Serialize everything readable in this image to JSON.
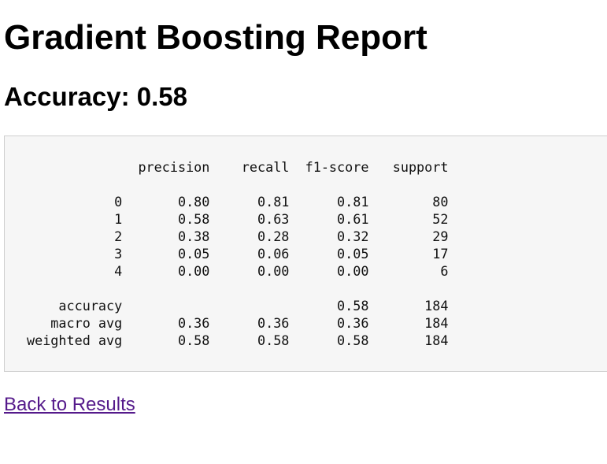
{
  "page": {
    "title": "Gradient Boosting Report",
    "accuracy_heading": "Accuracy: 0.58",
    "report_text": "              precision    recall  f1-score   support\n\n           0       0.80      0.81      0.81        80\n           1       0.58      0.63      0.61        52\n           2       0.38      0.28      0.32        29\n           3       0.05      0.06      0.05        17\n           4       0.00      0.00      0.00         6\n\n    accuracy                           0.58       184\n   macro avg       0.36      0.36      0.36       184\nweighted avg       0.58      0.58      0.58       184",
    "back_link": "Back to Results"
  },
  "colors": {
    "link": "#551a8b",
    "report_background": "#f6f6f6",
    "report_border": "#cfcfcf"
  }
}
